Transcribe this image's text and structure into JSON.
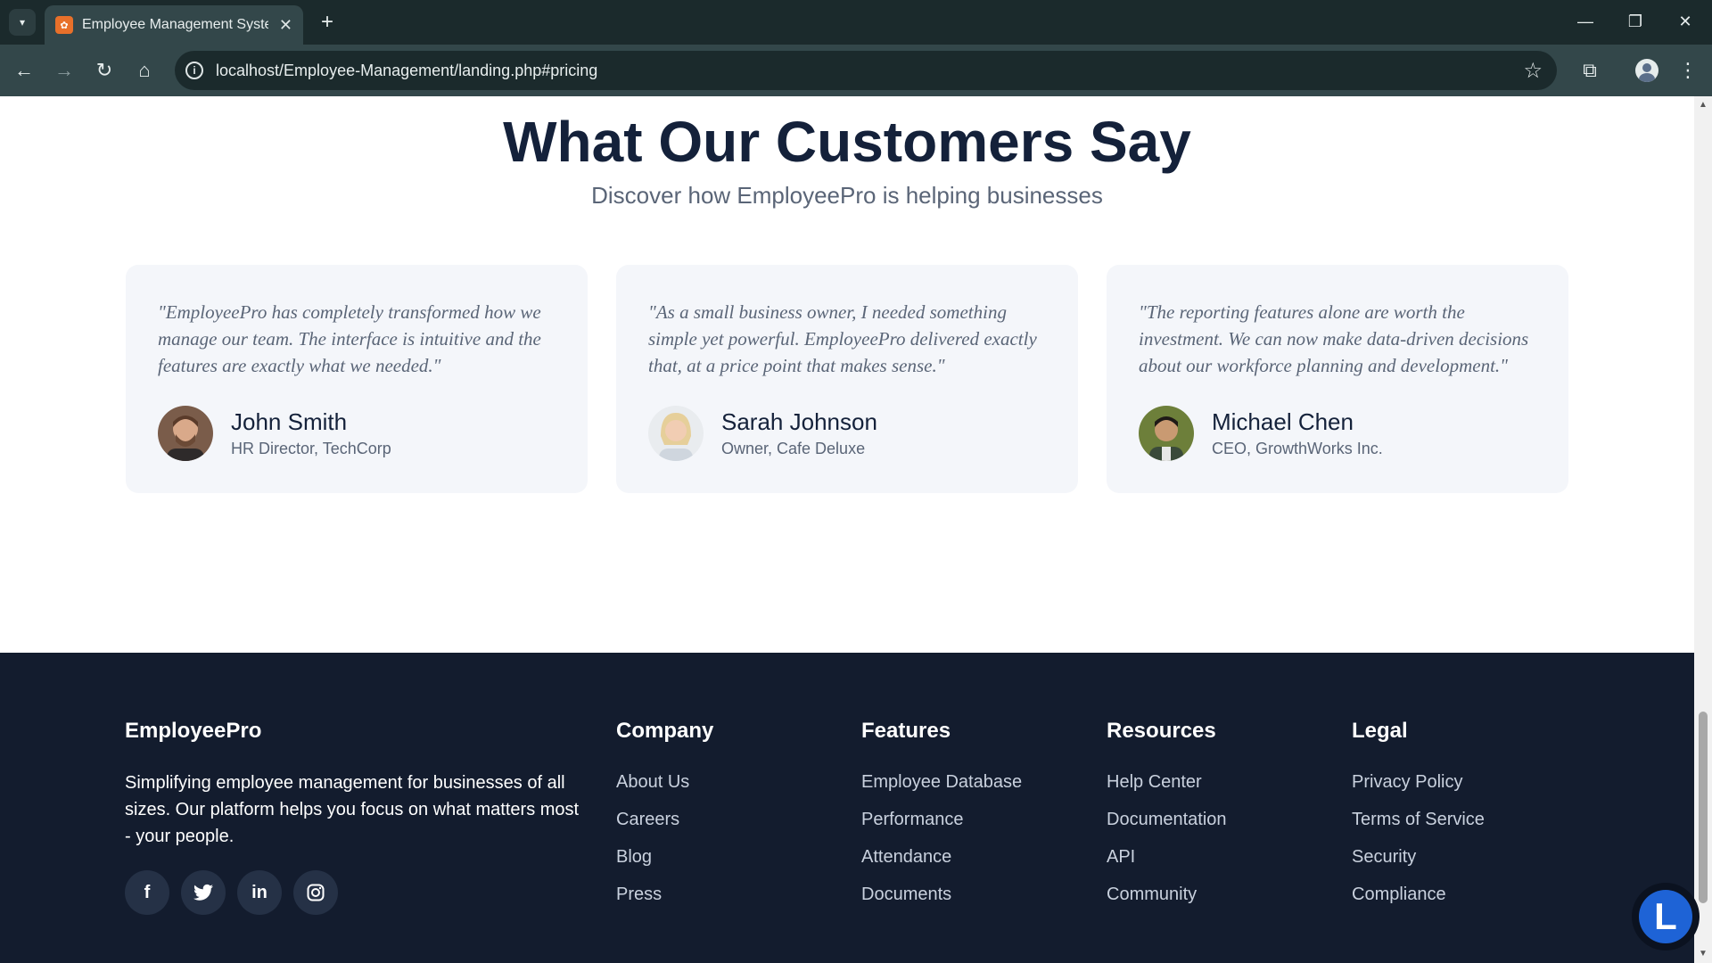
{
  "browser": {
    "tab_title": "Employee Management System",
    "url": "localhost/Employee-Management/landing.php#pricing"
  },
  "testimonials": {
    "title": "What Our Customers Say",
    "subtitle": "Discover how EmployeePro is helping businesses",
    "items": [
      {
        "quote": "\"EmployeePro has completely transformed how we manage our team. The interface is intuitive and the features are exactly what we needed.\"",
        "name": "John Smith",
        "role": "HR Director, TechCorp"
      },
      {
        "quote": "\"As a small business owner, I needed something simple yet powerful. EmployeePro delivered exactly that, at a price point that makes sense.\"",
        "name": "Sarah Johnson",
        "role": "Owner, Cafe Deluxe"
      },
      {
        "quote": "\"The reporting features alone are worth the investment. We can now make data-driven decisions about our workforce planning and development.\"",
        "name": "Michael Chen",
        "role": "CEO, GrowthWorks Inc."
      }
    ]
  },
  "footer": {
    "brand": "EmployeePro",
    "tagline": "Simplifying employee management for businesses of all sizes. Our platform helps you focus on what matters most - your people.",
    "social_icons": [
      "facebook-icon",
      "twitter-icon",
      "linkedin-icon",
      "instagram-icon"
    ],
    "columns": [
      {
        "heading": "Company",
        "links": [
          "About Us",
          "Careers",
          "Blog",
          "Press"
        ]
      },
      {
        "heading": "Features",
        "links": [
          "Employee Database",
          "Performance",
          "Attendance",
          "Documents"
        ]
      },
      {
        "heading": "Resources",
        "links": [
          "Help Center",
          "Documentation",
          "API",
          "Community"
        ]
      },
      {
        "heading": "Legal",
        "links": [
          "Privacy Policy",
          "Terms of Service",
          "Security",
          "Compliance"
        ]
      }
    ]
  },
  "help_badge": {
    "letter": "L"
  },
  "colors": {
    "heading": "#14213a",
    "footer_bg": "#131c2e",
    "card_bg": "#f4f6fa",
    "accent": "#1e63d6"
  }
}
